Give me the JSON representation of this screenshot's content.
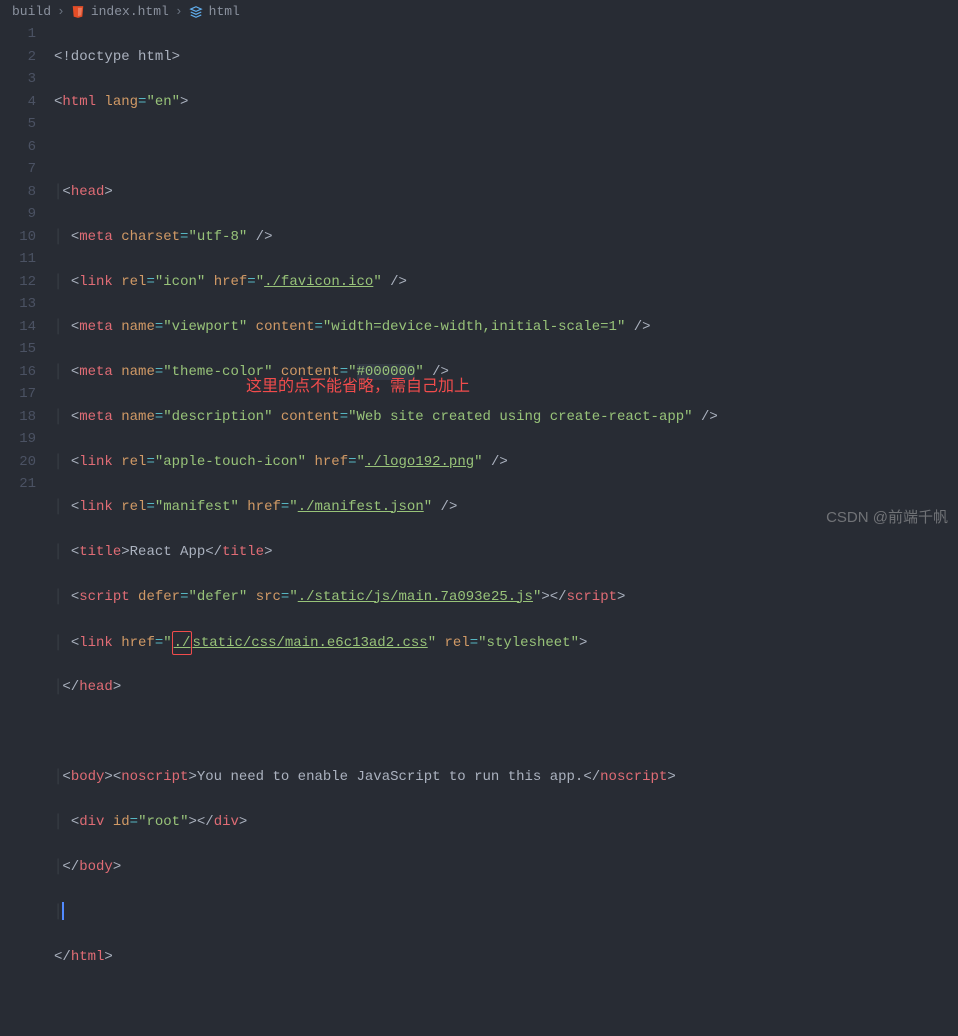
{
  "breadcrumb": {
    "seg1": "build",
    "seg2": "index.html",
    "seg3": "html"
  },
  "lines": {
    "l1_doctype": "!doctype",
    "l1_html": "html",
    "l2_tag": "html",
    "l2_attr": "lang",
    "l2_val": "\"en\"",
    "l4_tag": "head",
    "l5_tag": "meta",
    "l5_attr": "charset",
    "l5_val": "\"utf-8\"",
    "l6_tag": "link",
    "l6_a1": "rel",
    "l6_v1": "\"icon\"",
    "l6_a2": "href",
    "l6_v2_q": "\"",
    "l6_link": "./favicon.ico",
    "l7_tag": "meta",
    "l7_a1": "name",
    "l7_v1": "\"viewport\"",
    "l7_a2": "content",
    "l7_v2": "\"width=device-width,initial-scale=1\"",
    "l8_tag": "meta",
    "l8_a1": "name",
    "l8_v1": "\"theme-color\"",
    "l8_a2": "content",
    "l8_v2_q": "\"",
    "l8_color": "#000000",
    "l9_tag": "meta",
    "l9_a1": "name",
    "l9_v1": "\"description\"",
    "l9_a2": "content",
    "l9_v2": "\"Web site created using create-react-app\"",
    "l10_tag": "link",
    "l10_a1": "rel",
    "l10_v1": "\"apple-touch-icon\"",
    "l10_a2": "href",
    "l10_link": "./logo192.png",
    "l11_tag": "link",
    "l11_a1": "rel",
    "l11_v1": "\"manifest\"",
    "l11_a2": "href",
    "l11_link": "./manifest.json",
    "l12_tag": "title",
    "l12_text": "React App",
    "l13_tag": "script",
    "l13_a1": "defer",
    "l13_v1": "\"defer\"",
    "l13_a2": "src",
    "l13_link": "./static/js/main.7a093e25.js",
    "l14_tag": "link",
    "l14_a1": "href",
    "l14_box": "./",
    "l14_link": "static/css/main.e6c13ad2.css",
    "l14_a2": "rel",
    "l14_v2": "\"stylesheet\"",
    "l15_tag": "head",
    "l17_tag": "body",
    "l17_ns": "noscript",
    "l17_text": "You need to enable JavaScript to run this app.",
    "l18_tag": "div",
    "l18_a1": "id",
    "l18_v1": "\"root\"",
    "l19_tag": "body",
    "l21_tag": "html"
  },
  "lineNumbers": [
    "1",
    "2",
    "3",
    "4",
    "5",
    "6",
    "7",
    "8",
    "9",
    "10",
    "11",
    "12",
    "13",
    "14",
    "15",
    "16",
    "17",
    "18",
    "19",
    "20",
    "21"
  ],
  "annotation": "这里的点不能省略，需自己加上",
  "watermark": "CSDN @前端千帆"
}
